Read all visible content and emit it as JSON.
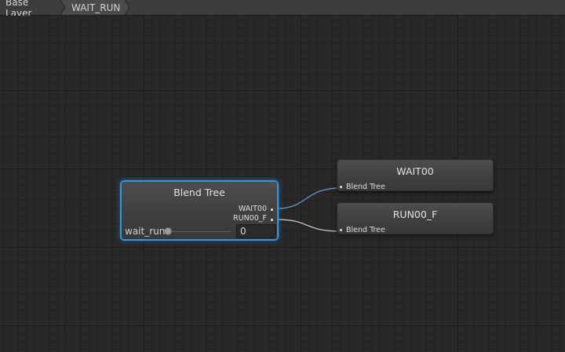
{
  "breadcrumb": {
    "items": [
      "Base Layer",
      "WAIT_RUN"
    ]
  },
  "blend_tree_node": {
    "title": "Blend Tree",
    "outputs": [
      "WAIT00",
      "RUN00_F"
    ],
    "parameter": {
      "name": "wait_run",
      "value": "0",
      "slider_fraction": 0
    }
  },
  "motion_nodes": [
    {
      "title": "WAIT00",
      "input_label": "Blend Tree"
    },
    {
      "title": "RUN00_F",
      "input_label": "Blend Tree"
    }
  ],
  "colors": {
    "background": "#282828",
    "breadcrumb_bar": "#3c3c3c",
    "selection_accent": "#3b9ce8",
    "wire_to_wait": "#5f8ebd",
    "wire_to_run": "#cfcfcf"
  }
}
